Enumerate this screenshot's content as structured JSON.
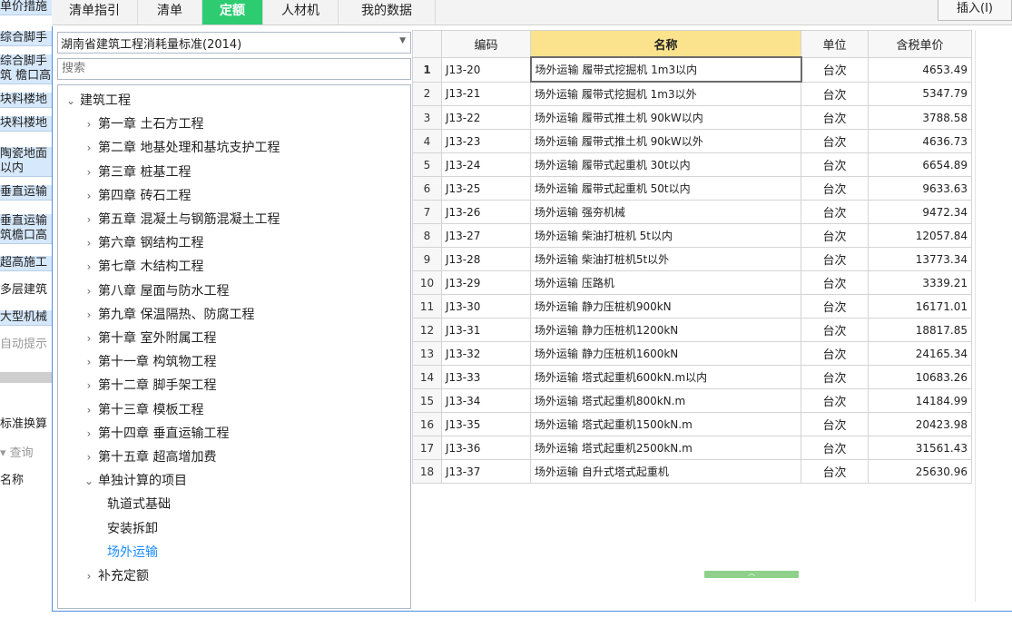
{
  "left_strip": {
    "items": [
      "单价措施",
      "综合脚手",
      "综合脚手",
      "筑 檐口高",
      "块料楼地",
      "块料楼地",
      "陶瓷地面",
      "以内",
      "垂直运输",
      "垂直运输",
      "筑檐口高",
      "超高施工",
      "多层建筑",
      "大型机械",
      "自动提示",
      "",
      "标准换算",
      "▾ 查询",
      "名称"
    ]
  },
  "tabs": [
    {
      "label": "清单指引"
    },
    {
      "label": "清单"
    },
    {
      "label": "定额"
    },
    {
      "label": "人材机"
    },
    {
      "label": "我的数据"
    }
  ],
  "insert_button": "插入(I)",
  "standard_select": "湖南省建筑工程消耗量标准(2014)",
  "search_placeholder": "搜索",
  "tree": [
    {
      "label": "建筑工程",
      "expanded": true
    },
    {
      "label": "第一章 土石方工程"
    },
    {
      "label": "第二章 地基处理和基坑支护工程"
    },
    {
      "label": "第三章 桩基工程"
    },
    {
      "label": "第四章 砖石工程"
    },
    {
      "label": "第五章 混凝土与钢筋混凝土工程"
    },
    {
      "label": "第六章 钢结构工程"
    },
    {
      "label": "第七章 木结构工程"
    },
    {
      "label": "第八章 屋面与防水工程"
    },
    {
      "label": "第九章 保温隔热、防腐工程"
    },
    {
      "label": "第十章 室外附属工程"
    },
    {
      "label": "第十一章 构筑物工程"
    },
    {
      "label": "第十二章 脚手架工程"
    },
    {
      "label": "第十三章 模板工程"
    },
    {
      "label": "第十四章 垂直运输工程"
    },
    {
      "label": "第十五章 超高增加费"
    },
    {
      "label": "单独计算的项目",
      "expanded": true
    },
    {
      "label": "轨道式基础"
    },
    {
      "label": "安装拆卸"
    },
    {
      "label": "场外运输",
      "selected": true
    },
    {
      "label": "补充定额"
    }
  ],
  "grid": {
    "headers": [
      "",
      "编码",
      "名称",
      "单位",
      "含税单价"
    ],
    "rows": [
      {
        "idx": "1",
        "code": "J13-20",
        "name": "场外运输 履带式挖掘机 1m3以内",
        "unit": "台次",
        "price": "4653.49"
      },
      {
        "idx": "2",
        "code": "J13-21",
        "name": "场外运输 履带式挖掘机 1m3以外",
        "unit": "台次",
        "price": "5347.79"
      },
      {
        "idx": "3",
        "code": "J13-22",
        "name": "场外运输 履带式推土机 90kW以内",
        "unit": "台次",
        "price": "3788.58"
      },
      {
        "idx": "4",
        "code": "J13-23",
        "name": "场外运输 履带式推土机 90kW以外",
        "unit": "台次",
        "price": "4636.73"
      },
      {
        "idx": "5",
        "code": "J13-24",
        "name": "场外运输 履带式起重机 30t以内",
        "unit": "台次",
        "price": "6654.89"
      },
      {
        "idx": "6",
        "code": "J13-25",
        "name": "场外运输 履带式起重机 50t以内",
        "unit": "台次",
        "price": "9633.63"
      },
      {
        "idx": "7",
        "code": "J13-26",
        "name": "场外运输 强夯机械",
        "unit": "台次",
        "price": "9472.34"
      },
      {
        "idx": "8",
        "code": "J13-27",
        "name": "场外运输 柴油打桩机 5t以内",
        "unit": "台次",
        "price": "12057.84"
      },
      {
        "idx": "9",
        "code": "J13-28",
        "name": "场外运输 柴油打桩机5t以外",
        "unit": "台次",
        "price": "13773.34"
      },
      {
        "idx": "10",
        "code": "J13-29",
        "name": "场外运输 压路机",
        "unit": "台次",
        "price": "3339.21"
      },
      {
        "idx": "11",
        "code": "J13-30",
        "name": "场外运输 静力压桩机900kN",
        "unit": "台次",
        "price": "16171.01"
      },
      {
        "idx": "12",
        "code": "J13-31",
        "name": "场外运输 静力压桩机1200kN",
        "unit": "台次",
        "price": "18817.85"
      },
      {
        "idx": "13",
        "code": "J13-32",
        "name": "场外运输 静力压桩机1600kN",
        "unit": "台次",
        "price": "24165.34"
      },
      {
        "idx": "14",
        "code": "J13-33",
        "name": "场外运输 塔式起重机600kN.m以内",
        "unit": "台次",
        "price": "10683.26"
      },
      {
        "idx": "15",
        "code": "J13-34",
        "name": "场外运输 塔式起重机800kN.m",
        "unit": "台次",
        "price": "14184.99"
      },
      {
        "idx": "16",
        "code": "J13-35",
        "name": "场外运输 塔式起重机1500kN.m",
        "unit": "台次",
        "price": "20423.98"
      },
      {
        "idx": "17",
        "code": "J13-36",
        "name": "场外运输 塔式起重机2500kN.m",
        "unit": "台次",
        "price": "31561.43"
      },
      {
        "idx": "18",
        "code": "J13-37",
        "name": "场外运输 自升式塔式起重机",
        "unit": "台次",
        "price": "25630.96"
      }
    ]
  },
  "colors": {
    "accent": "#2ecc71",
    "header_highlight": "#fbe38e",
    "selected_tree": "#1a8cff",
    "border": "#4a90e2"
  }
}
